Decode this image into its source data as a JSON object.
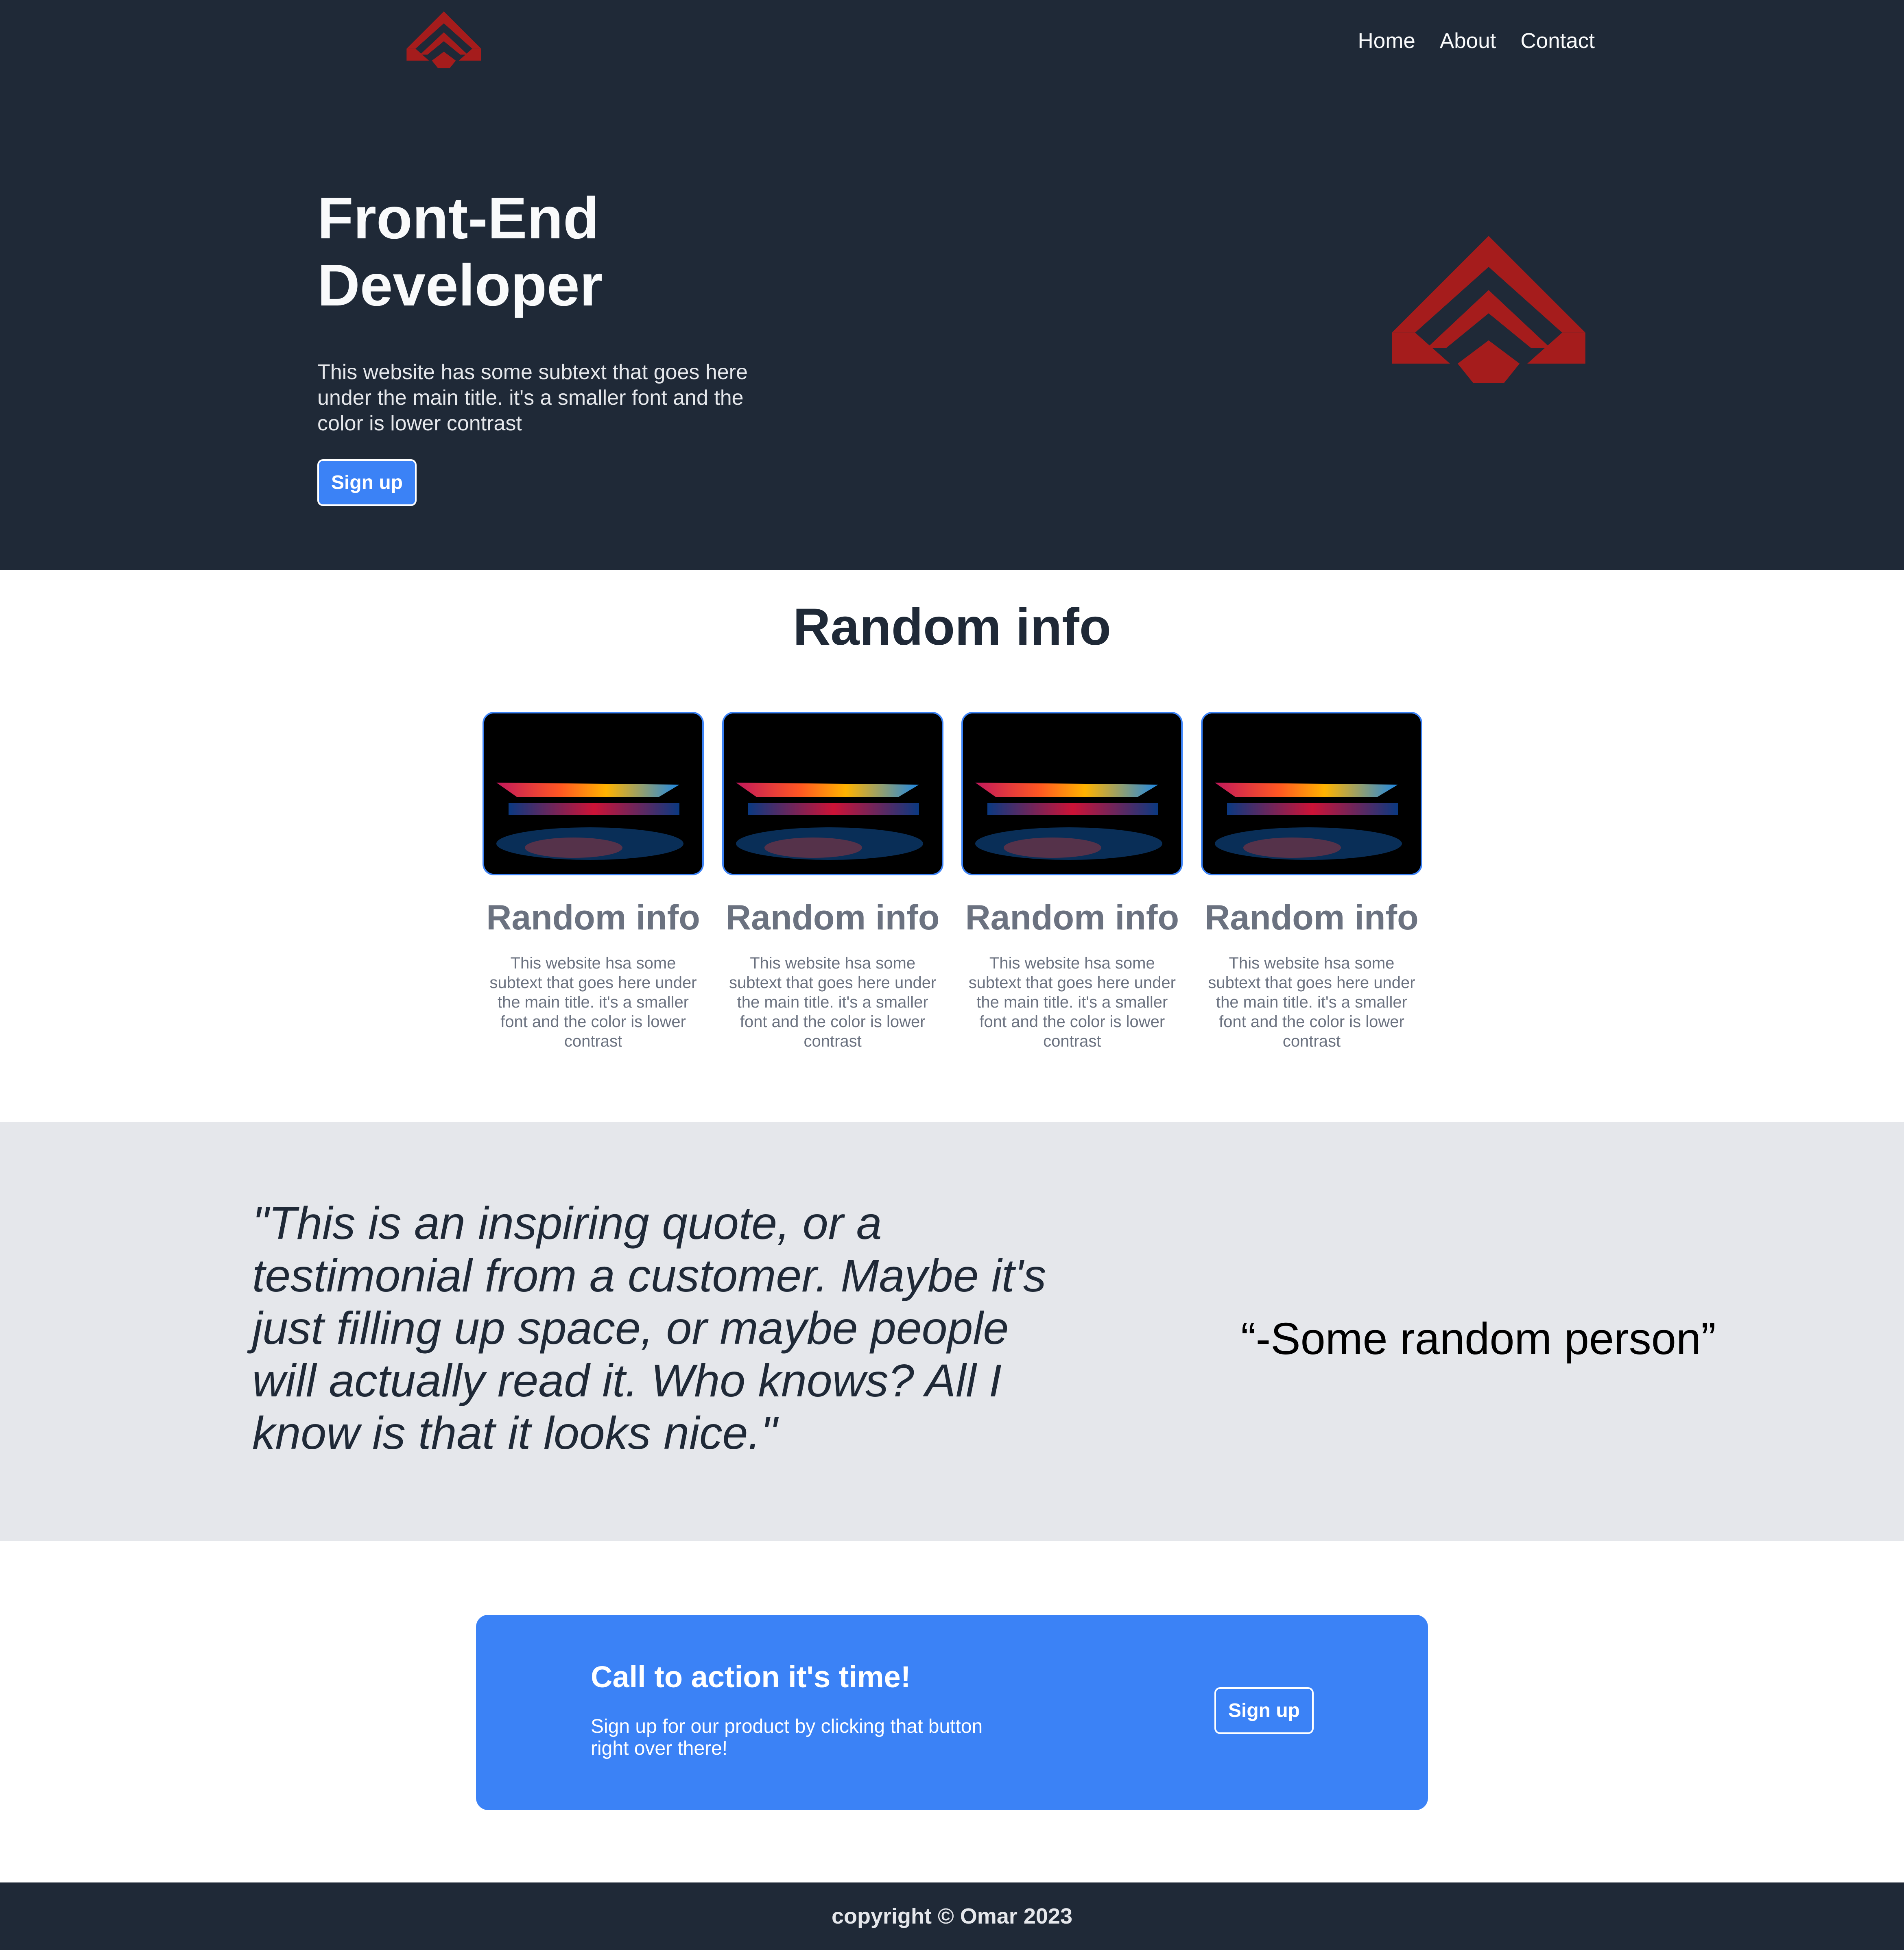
{
  "header": {
    "logo_icon": "red-chevron-logo-icon",
    "nav": [
      {
        "label": "Home"
      },
      {
        "label": "About"
      },
      {
        "label": "Contact"
      }
    ]
  },
  "hero": {
    "title": "Front-End Developer",
    "subtext": "This website has some subtext that goes here under the main title. it's a smaller font and the color is lower contrast",
    "button_label": "Sign up",
    "image_icon": "red-chevron-logo-icon"
  },
  "info": {
    "title": "Random info",
    "cards": [
      {
        "title": "Random info",
        "text": "This website hsa some subtext that goes here under the main title. it's a smaller font and the color is lower contrast"
      },
      {
        "title": "Random info",
        "text": "This website hsa some subtext that goes here under the main title. it's a smaller font and the color is lower contrast"
      },
      {
        "title": "Random info",
        "text": "This website hsa some subtext that goes here under the main title. it's a smaller font and the color is lower contrast"
      },
      {
        "title": "Random info",
        "text": "This website hsa some subtext that goes here under the main title. it's a smaller font and the color is lower contrast"
      }
    ]
  },
  "quote": {
    "text": "\"This is an inspiring quote, or a testimonial from a customer. Maybe it's just filling up space, or maybe people will actually read it. Who knows? All I know is that it looks nice.\"",
    "author": "“-Some random person”"
  },
  "cta": {
    "title": "Call to action it's time!",
    "text": "Sign up for our product by clicking that button right over there!",
    "button_label": "Sign up"
  },
  "footer": {
    "copyright": "copyright © Omar 2023"
  },
  "colors": {
    "dark": "#1f2937",
    "accent": "#3b82f6",
    "logo_red": "#a51c1c",
    "quote_bg": "#e5e7eb",
    "muted_text": "#6b7280"
  }
}
